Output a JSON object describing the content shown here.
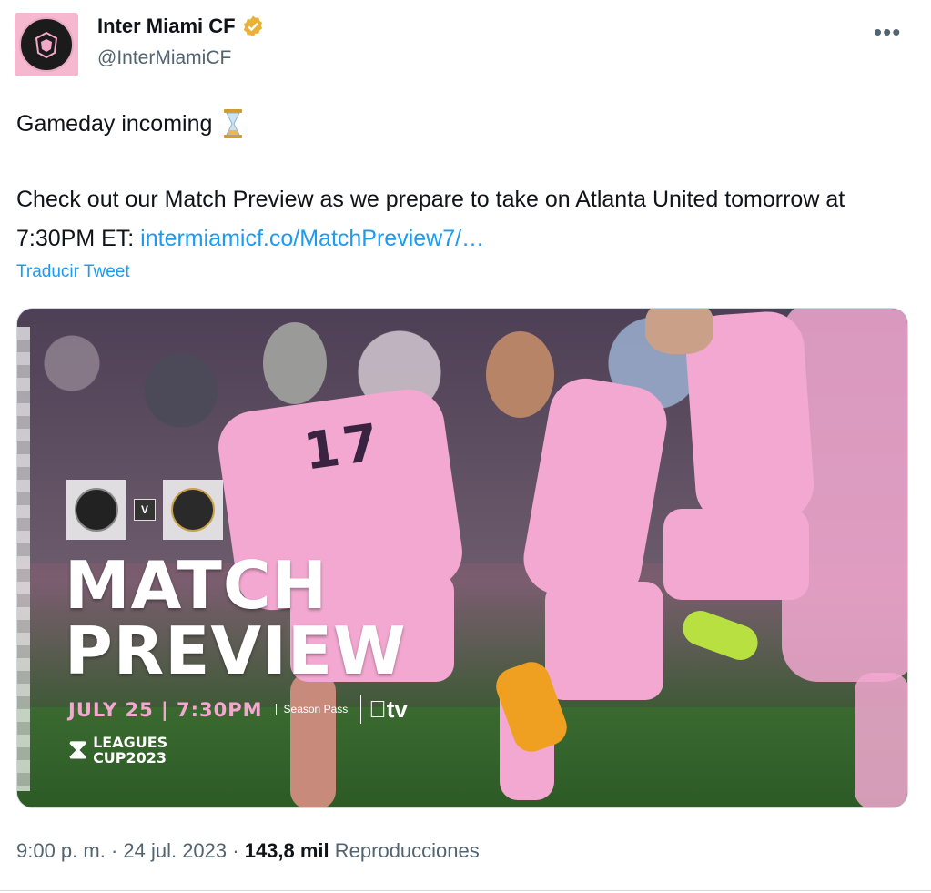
{
  "tweet": {
    "display_name": "Inter Miami CF",
    "handle": "@InterMiamiCF",
    "more_label": "•••",
    "line1": "Gameday incoming",
    "para_text": "Check out our Match Preview as we prepare to take on Atlanta United tomorrow at 7:30PM ET: ",
    "link": "intermiamicf.co/MatchPreview7/…",
    "translate": "Traducir Tweet",
    "time": "9:00 p. m. · 24 jul. 2023 · ",
    "views_num": "143,8 mil",
    "views_label": " Reproducciones"
  },
  "media": {
    "jersey_number": "17",
    "vs_label": "V",
    "headline_1": "MATCH",
    "headline_2": "PREVIEW",
    "date": "JULY 25 | 7:30PM",
    "season_pass": "Season Pass",
    "apple_tv": "tv",
    "leagues_1": "LEAGUES",
    "leagues_2": "CUP2023"
  },
  "colors": {
    "link": "#1d9bf0",
    "muted": "#536471",
    "verified": "#e8b13a",
    "pink": "#f4a7cf"
  },
  "icons": [
    "verified-badge-icon",
    "hourglass-emoji",
    "more-icon",
    "apple-icon"
  ]
}
